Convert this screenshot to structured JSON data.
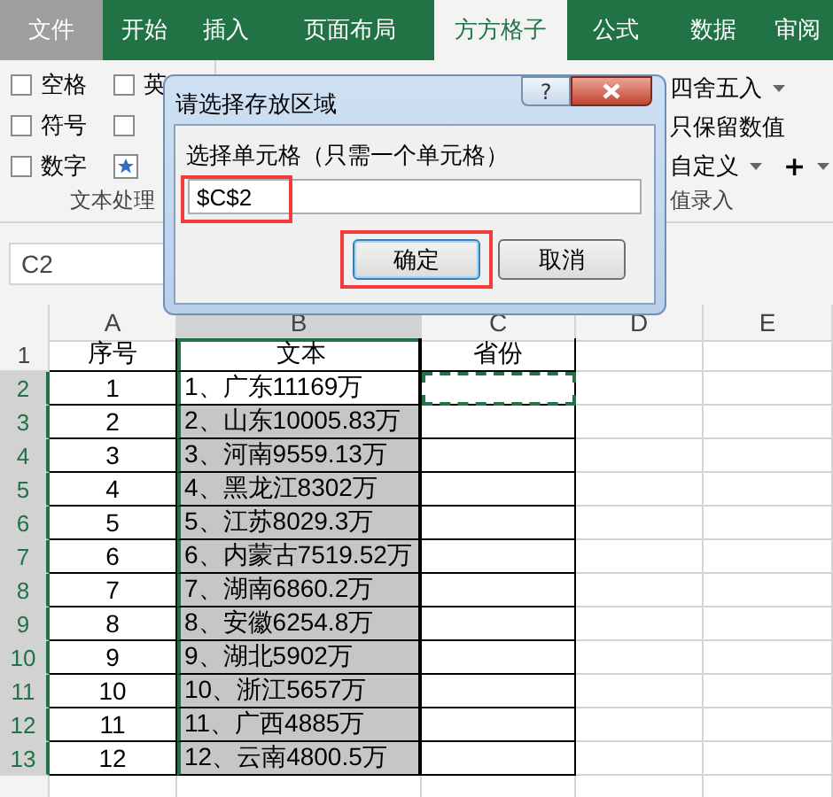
{
  "ribbon": {
    "tabs": [
      {
        "label": "文件",
        "kind": "file",
        "selected": false
      },
      {
        "label": "开始",
        "kind": "tab",
        "selected": false
      },
      {
        "label": "插入",
        "kind": "tab",
        "selected": false
      },
      {
        "label": "页面布局",
        "kind": "tab",
        "selected": false
      },
      {
        "label": "方方格子",
        "kind": "tab",
        "selected": true
      },
      {
        "label": "公式",
        "kind": "tab",
        "selected": false
      },
      {
        "label": "数据",
        "kind": "tab",
        "selected": false
      },
      {
        "label": "审阅",
        "kind": "tab",
        "selected": false
      }
    ],
    "left_items": [
      {
        "label": "空格",
        "kind": "checkbox",
        "checked": false
      },
      {
        "label": "英",
        "kind": "checkbox",
        "checked": false
      },
      {
        "label": "符号",
        "kind": "checkbox",
        "checked": false
      },
      {
        "kind": "checkbox",
        "checked": false
      },
      {
        "label": "数字",
        "kind": "checkbox",
        "checked": false
      },
      {
        "kind": "star",
        "checked": false
      }
    ],
    "left_group": "文本处理",
    "right_items": [
      {
        "label": "四舍五入",
        "dropdown": true
      },
      {
        "label": "只保留数值",
        "dropdown": false
      },
      {
        "label": "自定义",
        "dropdown": true
      }
    ],
    "plus": {
      "label": "+",
      "dropdown": true
    },
    "right_group": "值录入"
  },
  "dialog": {
    "title": "请选择存放区域",
    "help": "?",
    "prompt": "选择单元格（只需一个单元格）",
    "value": "$C$2",
    "field_highlighted": true,
    "buttons": [
      {
        "label": "确定",
        "kind": "primary",
        "highlighted": true
      },
      {
        "label": "取消",
        "kind": "normal",
        "highlighted": false
      }
    ]
  },
  "formula_bar": {
    "name_box": "C2"
  },
  "sheet": {
    "columns": [
      {
        "label": "A",
        "selected": false
      },
      {
        "label": "B",
        "selected": true
      },
      {
        "label": "C",
        "selected": false
      },
      {
        "label": "D",
        "selected": false
      },
      {
        "label": "E",
        "selected": false
      }
    ],
    "rows": [
      {
        "num": "1",
        "a": "序号",
        "b": "文本",
        "c": "省份",
        "selected": false,
        "highlighted": false,
        "marquee": false
      },
      {
        "num": "2",
        "a": "1",
        "b": "1、广东11169万",
        "selected": true,
        "highlighted": false,
        "marquee": true
      },
      {
        "num": "3",
        "a": "2",
        "b": "2、山东10005.83万",
        "selected": true,
        "highlighted": true,
        "marquee": false
      },
      {
        "num": "4",
        "a": "3",
        "b": "3、河南9559.13万",
        "selected": true,
        "highlighted": true,
        "marquee": false
      },
      {
        "num": "5",
        "a": "4",
        "b": "4、黑龙江8302万",
        "selected": true,
        "highlighted": true,
        "marquee": false
      },
      {
        "num": "6",
        "a": "5",
        "b": "5、江苏8029.3万",
        "selected": true,
        "highlighted": true,
        "marquee": false
      },
      {
        "num": "7",
        "a": "6",
        "b": "6、内蒙古7519.52万",
        "selected": true,
        "highlighted": true,
        "marquee": false
      },
      {
        "num": "8",
        "a": "7",
        "b": "7、湖南6860.2万",
        "selected": true,
        "highlighted": true,
        "marquee": false
      },
      {
        "num": "9",
        "a": "8",
        "b": "8、安徽6254.8万",
        "selected": true,
        "highlighted": true,
        "marquee": false
      },
      {
        "num": "10",
        "a": "9",
        "b": "9、湖北5902万",
        "selected": true,
        "highlighted": true,
        "marquee": false
      },
      {
        "num": "11",
        "a": "10",
        "b": "10、浙江5657万",
        "selected": true,
        "highlighted": true,
        "marquee": false
      },
      {
        "num": "12",
        "a": "11",
        "b": "11、广西4885万",
        "selected": true,
        "highlighted": true,
        "marquee": false
      },
      {
        "num": "13",
        "a": "12",
        "b": "12、云南4800.5万",
        "selected": true,
        "highlighted": true,
        "marquee": false
      }
    ]
  }
}
